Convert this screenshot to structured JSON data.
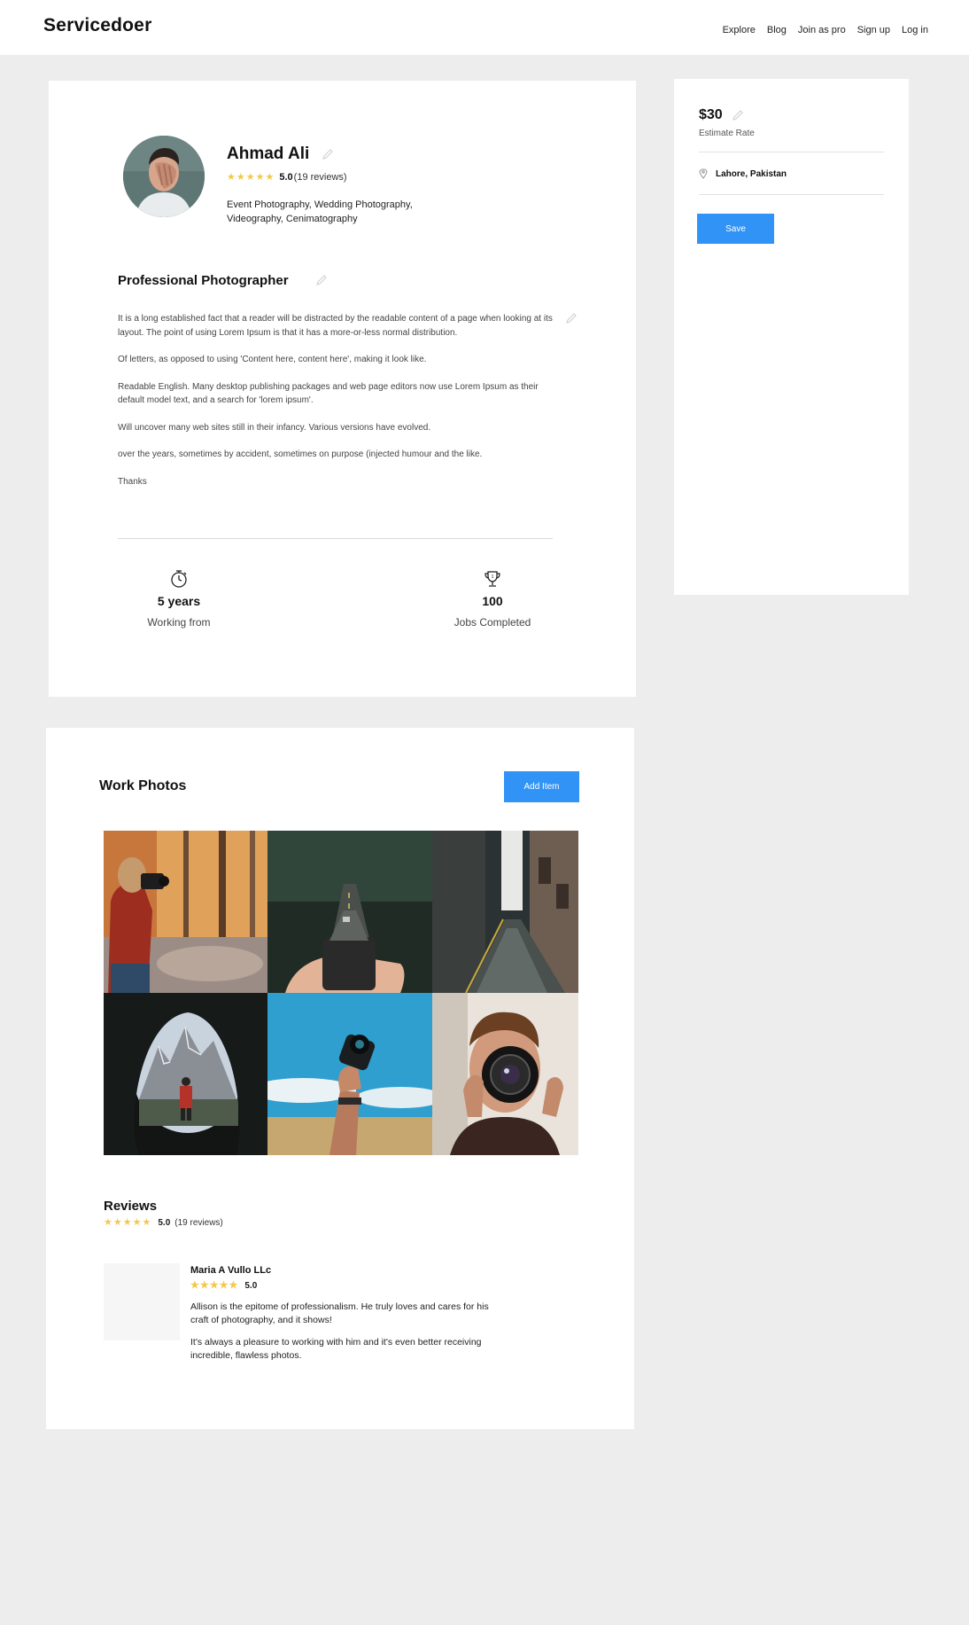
{
  "header": {
    "logo": "Servicedoer",
    "nav": [
      "Explore",
      "Blog",
      "Join as pro",
      "Sign up",
      "Log in"
    ]
  },
  "profile": {
    "name": "Ahmad Ali",
    "rating": "5.0",
    "reviews_count": "(19 reviews)",
    "stars": 5,
    "skills": "Event Photography, Wedding Photography, Videography, Cenimatography",
    "title": "Professional Photographer",
    "bio": [
      "It is a long established fact that a reader will be distracted by the readable content of a page when looking at its layout. The point of using Lorem Ipsum is that it has a more-or-less normal distribution.",
      "Of letters, as opposed to using 'Content here, content here', making it look like.",
      "Readable English. Many desktop publishing packages and web page editors  now use Lorem Ipsum as their default model text, and a search for 'lorem ipsum'.",
      "Will uncover many web sites still in their infancy. Various versions have evolved.",
      "over the years, sometimes by accident, sometimes on purpose (injected humour  and the like.",
      "Thanks"
    ],
    "stats": [
      {
        "value": "5 years",
        "label": "Working from",
        "icon": "stopwatch-icon"
      },
      {
        "value": "100",
        "label": "Jobs Completed",
        "icon": "trophy-icon"
      }
    ]
  },
  "rate_card": {
    "rate": "$30",
    "rate_label": "Estimate Rate",
    "location": "Lahore, Pakistan",
    "save_label": "Save"
  },
  "work_photos": {
    "title": "Work Photos",
    "add_label": "Add Item",
    "photos": [
      "autumn-forest-photographer",
      "hand-phone-road",
      "city-alley",
      "cave-mountains",
      "hand-camera-sky",
      "man-camera-lens"
    ]
  },
  "reviews": {
    "title": "Reviews",
    "rating": "5.0",
    "count": "(19 reviews)",
    "items": [
      {
        "name": "Maria A Vullo LLc",
        "rating": "5.0",
        "text": [
          "Allison is the epitome of professionalism. He truly loves and cares for his craft of photography, and it shows!",
          "It's always a pleasure to working with him and it's even better receiving incredible, flawless photos."
        ]
      }
    ]
  },
  "colors": {
    "accent": "#3293f6",
    "star": "#f2c94c",
    "background": "#ededed"
  }
}
